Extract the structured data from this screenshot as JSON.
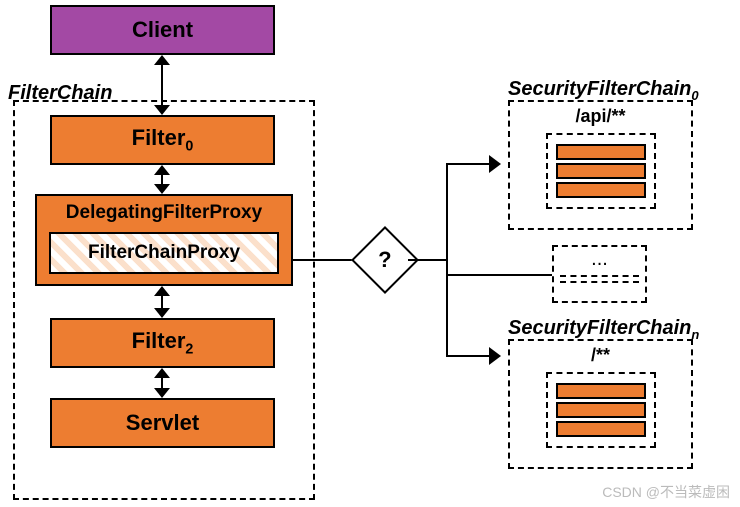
{
  "client": "Client",
  "filterchain_label": "FilterChain",
  "filter0_prefix": "Filter",
  "filter0_sub": "0",
  "delegating": "DelegatingFilterProxy",
  "fcp": "FilterChainProxy",
  "filter2_prefix": "Filter",
  "filter2_sub": "2",
  "servlet": "Servlet",
  "decision": "?",
  "sfc0_prefix": "SecurityFilterChain",
  "sfc0_sub": "0",
  "sfc0_path": "/api/**",
  "sfcn_prefix": "SecurityFilterChain",
  "sfcn_sub": "n",
  "sfcn_path": "/**",
  "ellipsis": "...",
  "watermark": "CSDN @不当菜虚困"
}
